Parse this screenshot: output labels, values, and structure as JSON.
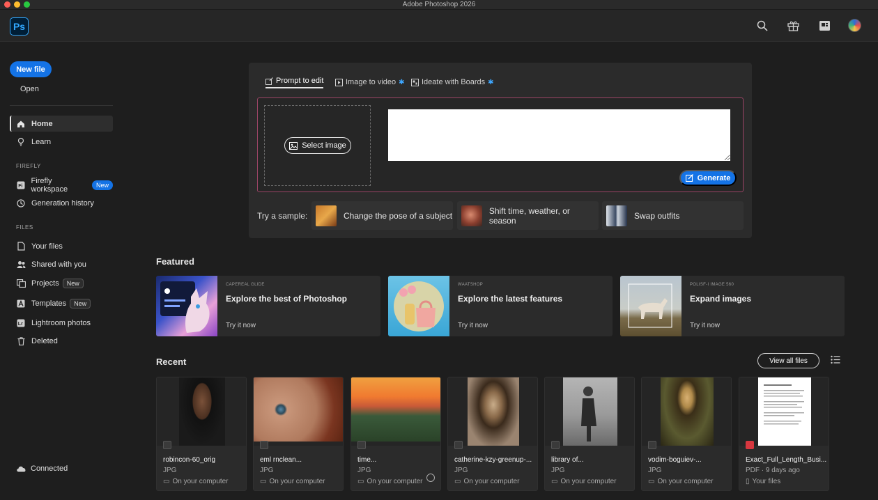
{
  "window": {
    "title": "Adobe Photoshop 2026"
  },
  "app": {
    "logo": "Ps"
  },
  "header": {
    "icons": [
      "search-icon",
      "gift-icon",
      "discover-icon",
      "avatar"
    ]
  },
  "sidebar": {
    "new_file": "New file",
    "open": "Open",
    "items": [
      {
        "label": "Home",
        "icon": "home-icon"
      },
      {
        "label": "Learn",
        "icon": "lightbulb-icon"
      }
    ],
    "firefly_section": "FIREFLY",
    "firefly_items": [
      {
        "label": "Firefly workspace",
        "badge": "New",
        "icon": "firefly-icon"
      },
      {
        "label": "Generation history",
        "icon": "history-icon"
      }
    ],
    "files_section": "FILES",
    "files_items": [
      {
        "label": "Your files",
        "icon": "file-icon"
      },
      {
        "label": "Shared with you",
        "icon": "people-icon"
      },
      {
        "label": "Projects",
        "badge": "New",
        "icon": "projects-icon"
      },
      {
        "label": "Templates",
        "badge": "New",
        "icon": "templates-icon"
      },
      {
        "label": "Lightroom photos",
        "icon": "lightroom-icon"
      },
      {
        "label": "Deleted",
        "icon": "trash-icon"
      }
    ],
    "status": "Connected"
  },
  "prompt_panel": {
    "tabs": [
      {
        "label": "Prompt to edit",
        "active": true
      },
      {
        "label": "Image to video",
        "starred": true
      },
      {
        "label": "Ideate with Boards",
        "starred": true
      }
    ],
    "select_image": "Select image",
    "prompt_value": "",
    "generate": "Generate",
    "try_label": "Try a sample:",
    "samples": [
      {
        "label": "Change the pose of a subject"
      },
      {
        "label": "Shift time, weather, or season"
      },
      {
        "label": "Swap outfits"
      }
    ]
  },
  "featured": {
    "title": "Featured",
    "cards": [
      {
        "kicker": "CAPEREAL GLIDE",
        "title": "Explore the best of Photoshop",
        "cta": "Try it now"
      },
      {
        "kicker": "WAATSHOP",
        "title": "Explore the latest features",
        "cta": "Try it now"
      },
      {
        "kicker": "POLISF-I IMAGE 560",
        "title": "Expand images",
        "cta": "Try it now"
      }
    ]
  },
  "recent": {
    "title": "Recent",
    "view_all": "View all files",
    "files": [
      {
        "name": "robincon-60_orig",
        "type": "JPG",
        "location": "On your computer"
      },
      {
        "name": "eml rnclean...",
        "type": "JPG",
        "location": "On your computer"
      },
      {
        "name": "time...",
        "type": "JPG",
        "location": "On your computer"
      },
      {
        "name": "catherine-kzy-greenup-...",
        "type": "JPG",
        "location": "On your computer"
      },
      {
        "name": "library of...",
        "type": "JPG",
        "location": "On your computer"
      },
      {
        "name": "vodim-boguiev-...",
        "type": "JPG",
        "location": "On your computer"
      },
      {
        "name": "Exact_Full_Length_Busi...",
        "type": "PDF · 9 days ago",
        "location": "Your files"
      }
    ]
  },
  "colors": {
    "accent": "#1473e6",
    "background": "#1e1e1e",
    "panel": "#2b2b2b"
  }
}
